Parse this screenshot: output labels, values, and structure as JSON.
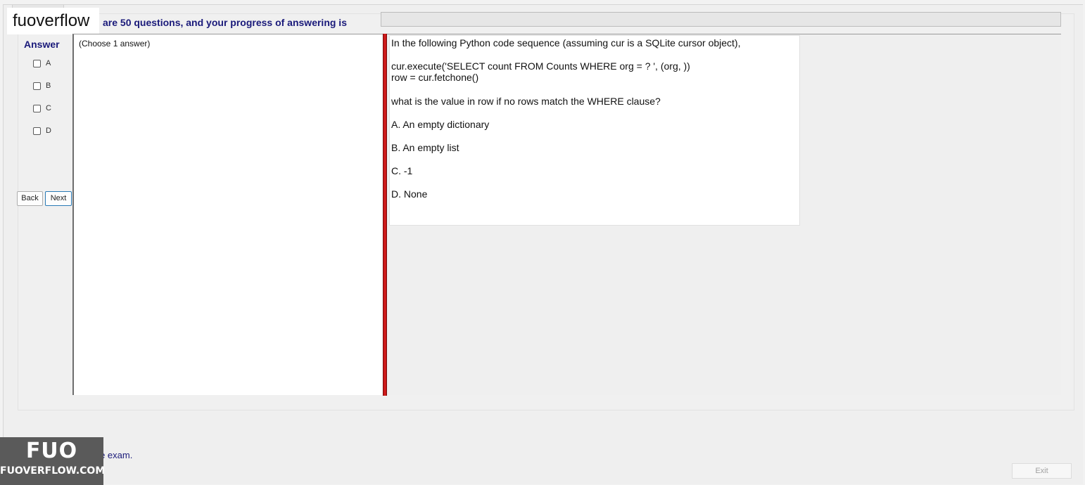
{
  "logo": {
    "text": "fuoverflow"
  },
  "header": {
    "progress_text": "are 50 questions, and your progress of answering is",
    "progress_fraction": 0.0
  },
  "answer_panel": {
    "heading": "Answer",
    "options": [
      "A",
      "B",
      "C",
      "D"
    ],
    "back_label": "Back",
    "next_label": "Next",
    "choose_text": "(Choose 1 answer)"
  },
  "question": {
    "line1": "In the following Python code sequence (assuming cur is a SQLite cursor object),",
    "code_line1": "cur.execute('SELECT count FROM Counts WHERE org = ? ', (org, ))",
    "code_line2": "row = cur.fetchone()",
    "prompt": "what is the value in row if no rows match the WHERE clause?",
    "choices": [
      "A.  An empty dictionary",
      "B.  An empty list",
      "C.  -1",
      "D.  None"
    ]
  },
  "footer": {
    "finish_text": "ish the exam.",
    "exit_label": "Exit"
  },
  "badge": {
    "top": "FUO",
    "bottom": "FUOVERFLOW.COM"
  },
  "colors": {
    "heading_blue": "#1a1a7a",
    "divider_red": "#cc1a1a",
    "badge_gray": "#5a5a5a"
  }
}
